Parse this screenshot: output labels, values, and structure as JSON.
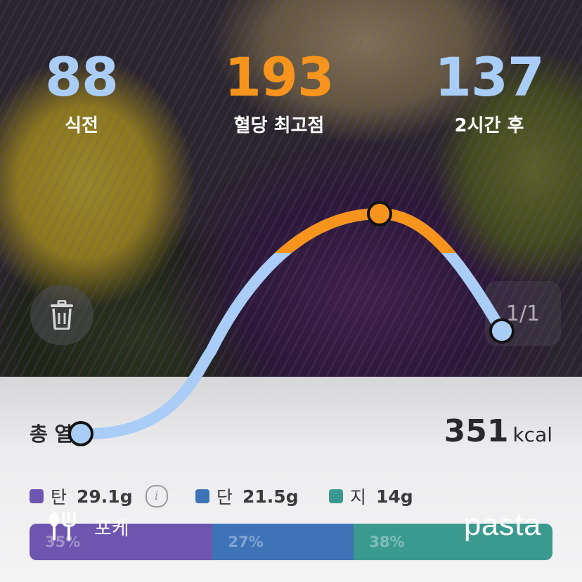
{
  "stats": {
    "before": {
      "value": "88",
      "label": "식전"
    },
    "peak": {
      "value": "193",
      "label": "혈당 최고점"
    },
    "after2h": {
      "value": "137",
      "label": "2시간 후"
    }
  },
  "glucose_curve": {
    "points": [
      {
        "label": "식전",
        "value": 88
      },
      {
        "label": "혈당 최고점",
        "value": 193
      },
      {
        "label": "2시간 후",
        "value": 137
      }
    ]
  },
  "photo_counter": "1/1",
  "summary": {
    "total_label": "총 열량",
    "kcal_value": "351",
    "kcal_unit": "kcal"
  },
  "macros": [
    {
      "name": "탄",
      "amount": "29.1g",
      "percent": "35%",
      "color": "#6e55b0",
      "fraction": 0.35
    },
    {
      "name": "단",
      "amount": "21.5g",
      "percent": "27%",
      "color": "#3f73b8",
      "fraction": 0.27
    },
    {
      "name": "지",
      "amount": "14g",
      "percent": "38%",
      "color": "#3a9a90",
      "fraction": 0.38
    }
  ],
  "food": {
    "name": "포케"
  },
  "brand": "pasta",
  "colors": {
    "peak_accent": "#f7941d",
    "curve_blue": "#a9cdf7"
  }
}
